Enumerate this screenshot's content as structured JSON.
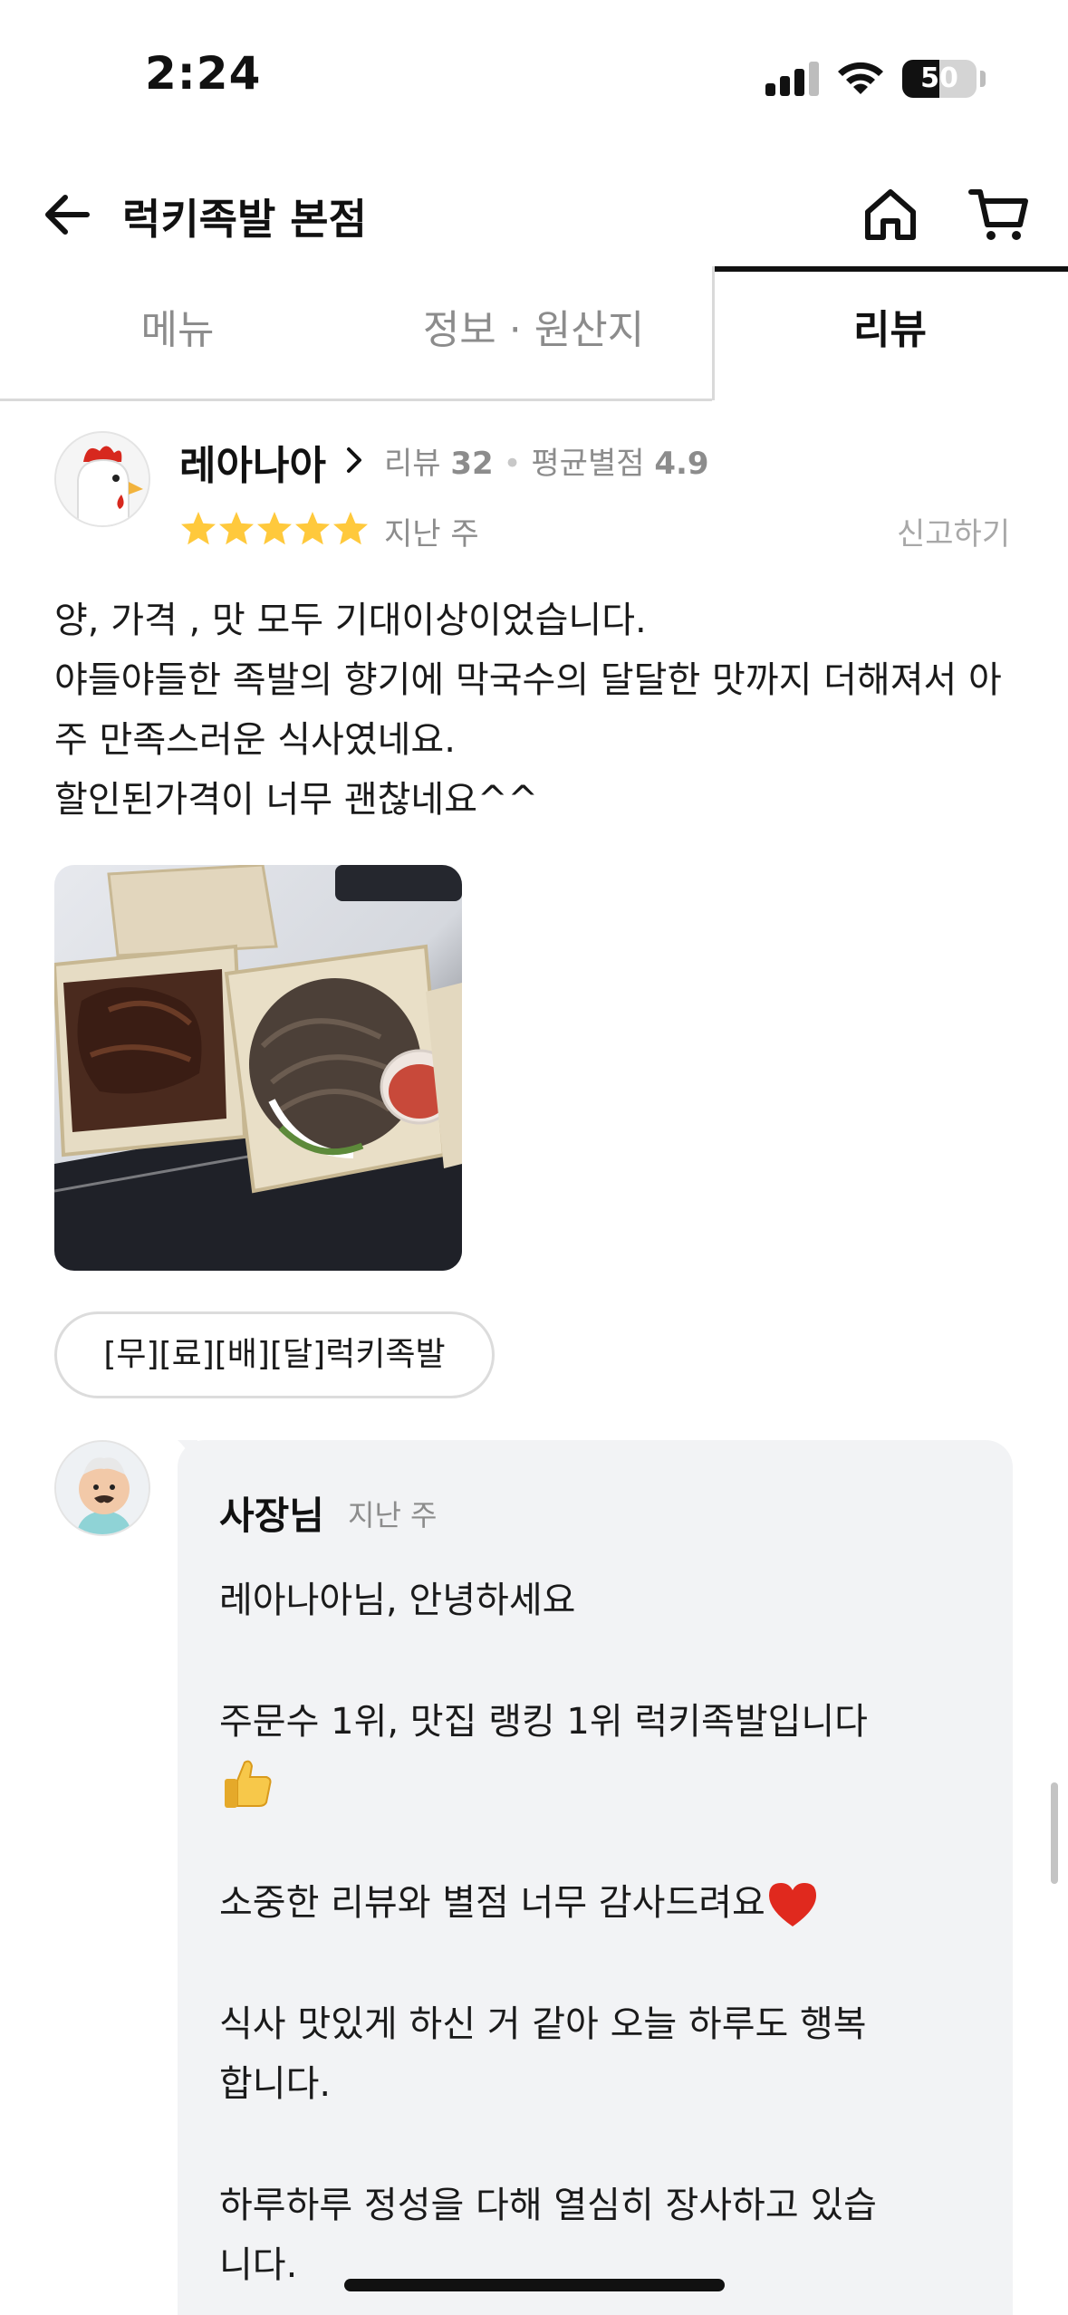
{
  "status_bar": {
    "time": "2:24",
    "battery": "50",
    "battery_level": 0.5
  },
  "header": {
    "title": "럭키족발 본점",
    "back_icon": "arrow-left-icon",
    "home_icon": "home-icon",
    "cart_icon": "cart-icon"
  },
  "tabs": [
    {
      "label": "메뉴",
      "selected": false
    },
    {
      "label": "정보 · 원산지",
      "selected": false
    },
    {
      "label": "리뷰",
      "selected": true
    }
  ],
  "review": {
    "reviewer_name": "레아나아",
    "stats_review_label": "리뷰",
    "stats_review_count": "32",
    "stats_rating_label": "평균별점",
    "stats_rating_value": "4.9",
    "rating": 5,
    "time": "지난 주",
    "report_label": "신고하기",
    "text": "양, 가격 , 맛 모두 기대이상이었습니다.\n야들야들한 족발의 향기에 막국수의 달달한 맛까지 더해져서 아주 만족스러운 식사였네요.\n할인된가격이 너무 괜찮네요^^",
    "menu_chip": "[무][료][배][달]럭키족발",
    "star_color": "#FFC93C"
  },
  "owner_reply": {
    "name": "사장님",
    "time": "지난 주",
    "line1": "레아나아님,  안녕하세요",
    "line2": "주문수 1위, 맛집 랭킹 1위 럭키족발입니다",
    "line3": "소중한 리뷰와 별점 너무 감사드려요",
    "line4a": "식사 맛있게 하신 거 같아 오늘 하루도 행복",
    "line4b": "합니다.",
    "line5a": "하루하루 정성을 다해 열심히 장사하고 있습",
    "line5b": "니다.",
    "emoji_thumb": "thumbs-up-icon",
    "emoji_heart": "red-heart-icon"
  }
}
